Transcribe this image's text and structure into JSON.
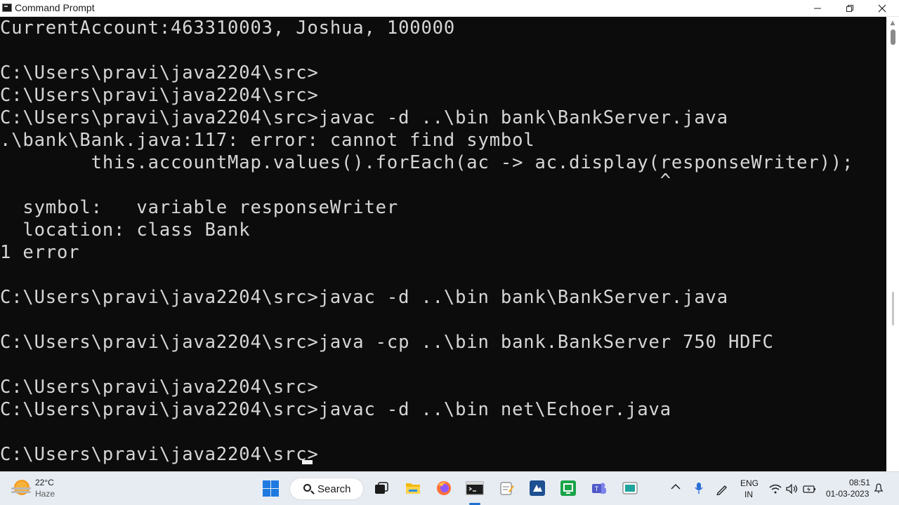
{
  "window": {
    "title": "Command Prompt"
  },
  "console": {
    "lines": [
      "CurrentAccount:463310003, Joshua, 100000",
      "",
      "C:\\Users\\pravi\\java2204\\src>",
      "C:\\Users\\pravi\\java2204\\src>",
      "C:\\Users\\pravi\\java2204\\src>javac -d ..\\bin bank\\BankServer.java",
      ".\\bank\\Bank.java:117: error: cannot find symbol",
      "        this.accountMap.values().forEach(ac -> ac.display(responseWriter));",
      "                                                          ^",
      "  symbol:   variable responseWriter",
      "  location: class Bank",
      "1 error",
      "",
      "C:\\Users\\pravi\\java2204\\src>javac -d ..\\bin bank\\BankServer.java",
      "",
      "C:\\Users\\pravi\\java2204\\src>java -cp ..\\bin bank.BankServer 750 HDFC",
      "",
      "C:\\Users\\pravi\\java2204\\src>",
      "C:\\Users\\pravi\\java2204\\src>javac -d ..\\bin net\\Echoer.java",
      "",
      "C:\\Users\\pravi\\java2204\\src>"
    ]
  },
  "taskbar": {
    "weather": {
      "temp": "22°C",
      "condition": "Haze"
    },
    "search_label": "Search",
    "pinned": [
      "task-view-icon",
      "file-explorer-icon",
      "firefox-icon",
      "terminal-icon",
      "notepad-icon",
      "app-icon",
      "app-icon",
      "teams-icon",
      "app-icon"
    ],
    "tray": {
      "lang_line1": "ENG",
      "lang_line2": "IN",
      "time": "08:51",
      "date": "01-03-2023"
    }
  }
}
